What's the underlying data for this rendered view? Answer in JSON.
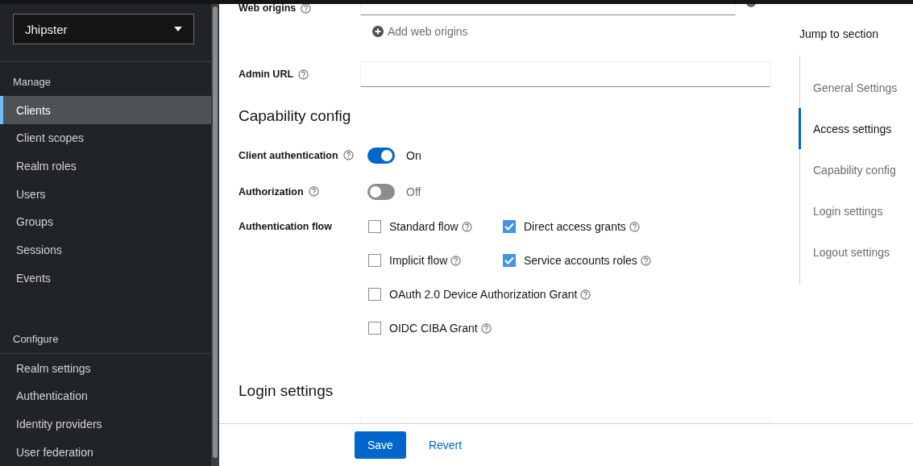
{
  "sidebar": {
    "realm_selector": "Jhipster",
    "sections": [
      {
        "title": "Manage",
        "items": [
          {
            "label": "Clients",
            "selected": true
          },
          {
            "label": "Client scopes",
            "selected": false
          },
          {
            "label": "Realm roles",
            "selected": false
          },
          {
            "label": "Users",
            "selected": false
          },
          {
            "label": "Groups",
            "selected": false
          },
          {
            "label": "Sessions",
            "selected": false
          },
          {
            "label": "Events",
            "selected": false
          }
        ]
      },
      {
        "title": "Configure",
        "items": [
          {
            "label": "Realm settings",
            "selected": false
          },
          {
            "label": "Authentication",
            "selected": false
          },
          {
            "label": "Identity providers",
            "selected": false
          },
          {
            "label": "User federation",
            "selected": false
          }
        ]
      }
    ]
  },
  "form": {
    "web_origins": {
      "label": "Web origins",
      "add_link": "Add web origins"
    },
    "admin_url": {
      "label": "Admin URL"
    },
    "capability": {
      "title": "Capability config",
      "toggles": [
        {
          "label": "Client authentication",
          "on": true,
          "state_text": "On"
        },
        {
          "label": "Authorization",
          "on": false,
          "state_text": "Off"
        }
      ],
      "authentication_flow": {
        "label": "Authentication flow",
        "rows": [
          [
            {
              "label": "Standard flow",
              "checked": false
            },
            {
              "label": "Direct access grants",
              "checked": true
            }
          ],
          [
            {
              "label": "Implicit flow",
              "checked": false
            },
            {
              "label": "Service accounts roles",
              "checked": true
            }
          ],
          [
            {
              "label": "OAuth 2.0 Device Authorization Grant",
              "checked": false
            }
          ],
          [
            {
              "label": "OIDC CIBA Grant",
              "checked": false
            }
          ]
        ]
      }
    },
    "login_settings": {
      "title": "Login settings"
    }
  },
  "footer": {
    "buttons": [
      {
        "label": "Save",
        "kind": "primary"
      },
      {
        "label": "Revert",
        "kind": "link"
      }
    ]
  },
  "jump_to_section": {
    "title": "Jump to section",
    "items": [
      {
        "label": "General Settings",
        "selected": false
      },
      {
        "label": "Access settings",
        "selected": true
      },
      {
        "label": "Capability config",
        "selected": false
      },
      {
        "label": "Login settings",
        "selected": false
      },
      {
        "label": "Logout settings",
        "selected": false
      }
    ]
  }
}
